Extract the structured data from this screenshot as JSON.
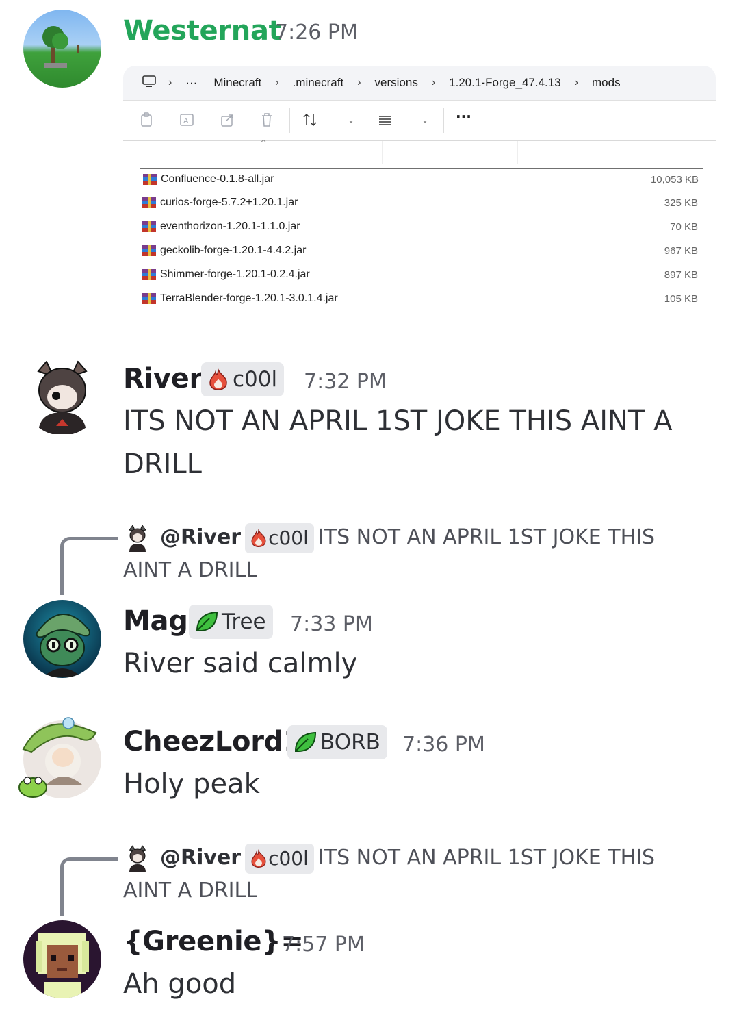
{
  "messages": [
    {
      "user": "Westernat",
      "time": "7:26 PM",
      "user_color": "#23a55a",
      "attachment": {
        "breadcrumb": [
          "Minecraft",
          ".minecraft",
          "versions",
          "1.20.1-Forge_47.4.13",
          "mods"
        ],
        "ellipsis": "···",
        "files": [
          {
            "name": "Confluence-0.1.8-all.jar",
            "size": "10,053 KB"
          },
          {
            "name": "curios-forge-5.7.2+1.20.1.jar",
            "size": "325 KB"
          },
          {
            "name": "eventhorizon-1.20.1-1.1.0.jar",
            "size": "70 KB"
          },
          {
            "name": "geckolib-forge-1.20.1-4.4.2.jar",
            "size": "967 KB"
          },
          {
            "name": "Shimmer-forge-1.20.1-0.2.4.jar",
            "size": "897 KB"
          },
          {
            "name": "TerraBlender-forge-1.20.1-3.0.1.4.jar",
            "size": "105 KB"
          }
        ]
      }
    },
    {
      "user": "River",
      "role": "c00l",
      "role_icon": "fire-icon",
      "time": "7:32 PM",
      "text_line1": "ITS NOT AN APRIL 1ST JOKE THIS AINT A",
      "text_line2": "DRILL"
    },
    {
      "reply": {
        "name": "@River",
        "role": "c00l",
        "line1": "ITS NOT AN APRIL 1ST JOKE THIS",
        "line2": "AINT A DRILL"
      },
      "user": "Mag",
      "role": "Tree",
      "role_icon": "leaf-icon",
      "time": "7:33 PM",
      "text": "River said calmly"
    },
    {
      "user": "CheezLord1",
      "role": "BORB",
      "role_icon": "leaf-icon",
      "time": "7:36 PM",
      "text": "Holy peak"
    },
    {
      "reply": {
        "name": "@River",
        "role": "c00l",
        "line1": "ITS NOT AN APRIL 1ST JOKE THIS",
        "line2": "AINT A DRILL"
      },
      "user": "{Greenie}=",
      "time": "7:57 PM",
      "text": "Ah good"
    }
  ]
}
